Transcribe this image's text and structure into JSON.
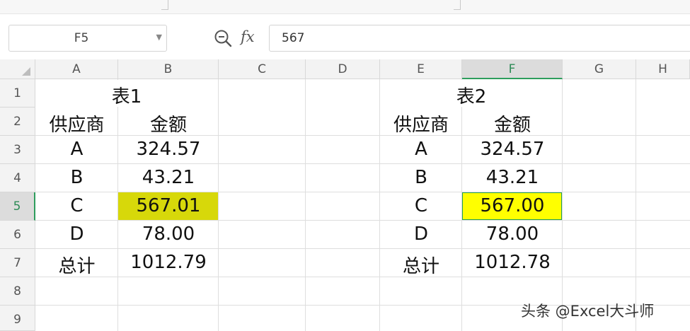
{
  "formula_bar": {
    "cell_reference": "F5",
    "fx_label": "fx",
    "formula_value": "567"
  },
  "grid": {
    "columns": [
      "A",
      "B",
      "C",
      "D",
      "E",
      "F",
      "G",
      "H"
    ],
    "rows": [
      "1",
      "2",
      "3",
      "4",
      "5",
      "6",
      "7",
      "8",
      "9"
    ],
    "selected_column": "F",
    "selected_row": "5",
    "highlight_colors": {
      "table1_cell": "#d7d80a",
      "table2_cell": "#ffff00"
    }
  },
  "table1": {
    "title": "表1",
    "header_supplier": "供应商",
    "header_amount": "金额",
    "rows": [
      {
        "supplier": "A",
        "amount": "324.57"
      },
      {
        "supplier": "B",
        "amount": "43.21"
      },
      {
        "supplier": "C",
        "amount": "567.01"
      },
      {
        "supplier": "D",
        "amount": "78.00"
      },
      {
        "supplier": "总计",
        "amount": "1012.79"
      }
    ]
  },
  "table2": {
    "title": "表2",
    "header_supplier": "供应商",
    "header_amount": "金额",
    "rows": [
      {
        "supplier": "A",
        "amount": "324.57"
      },
      {
        "supplier": "B",
        "amount": "43.21"
      },
      {
        "supplier": "C",
        "amount": "567.00"
      },
      {
        "supplier": "D",
        "amount": "78.00"
      },
      {
        "supplier": "总计",
        "amount": "1012.78"
      }
    ]
  },
  "watermark": "头条 @Excel大斗师"
}
